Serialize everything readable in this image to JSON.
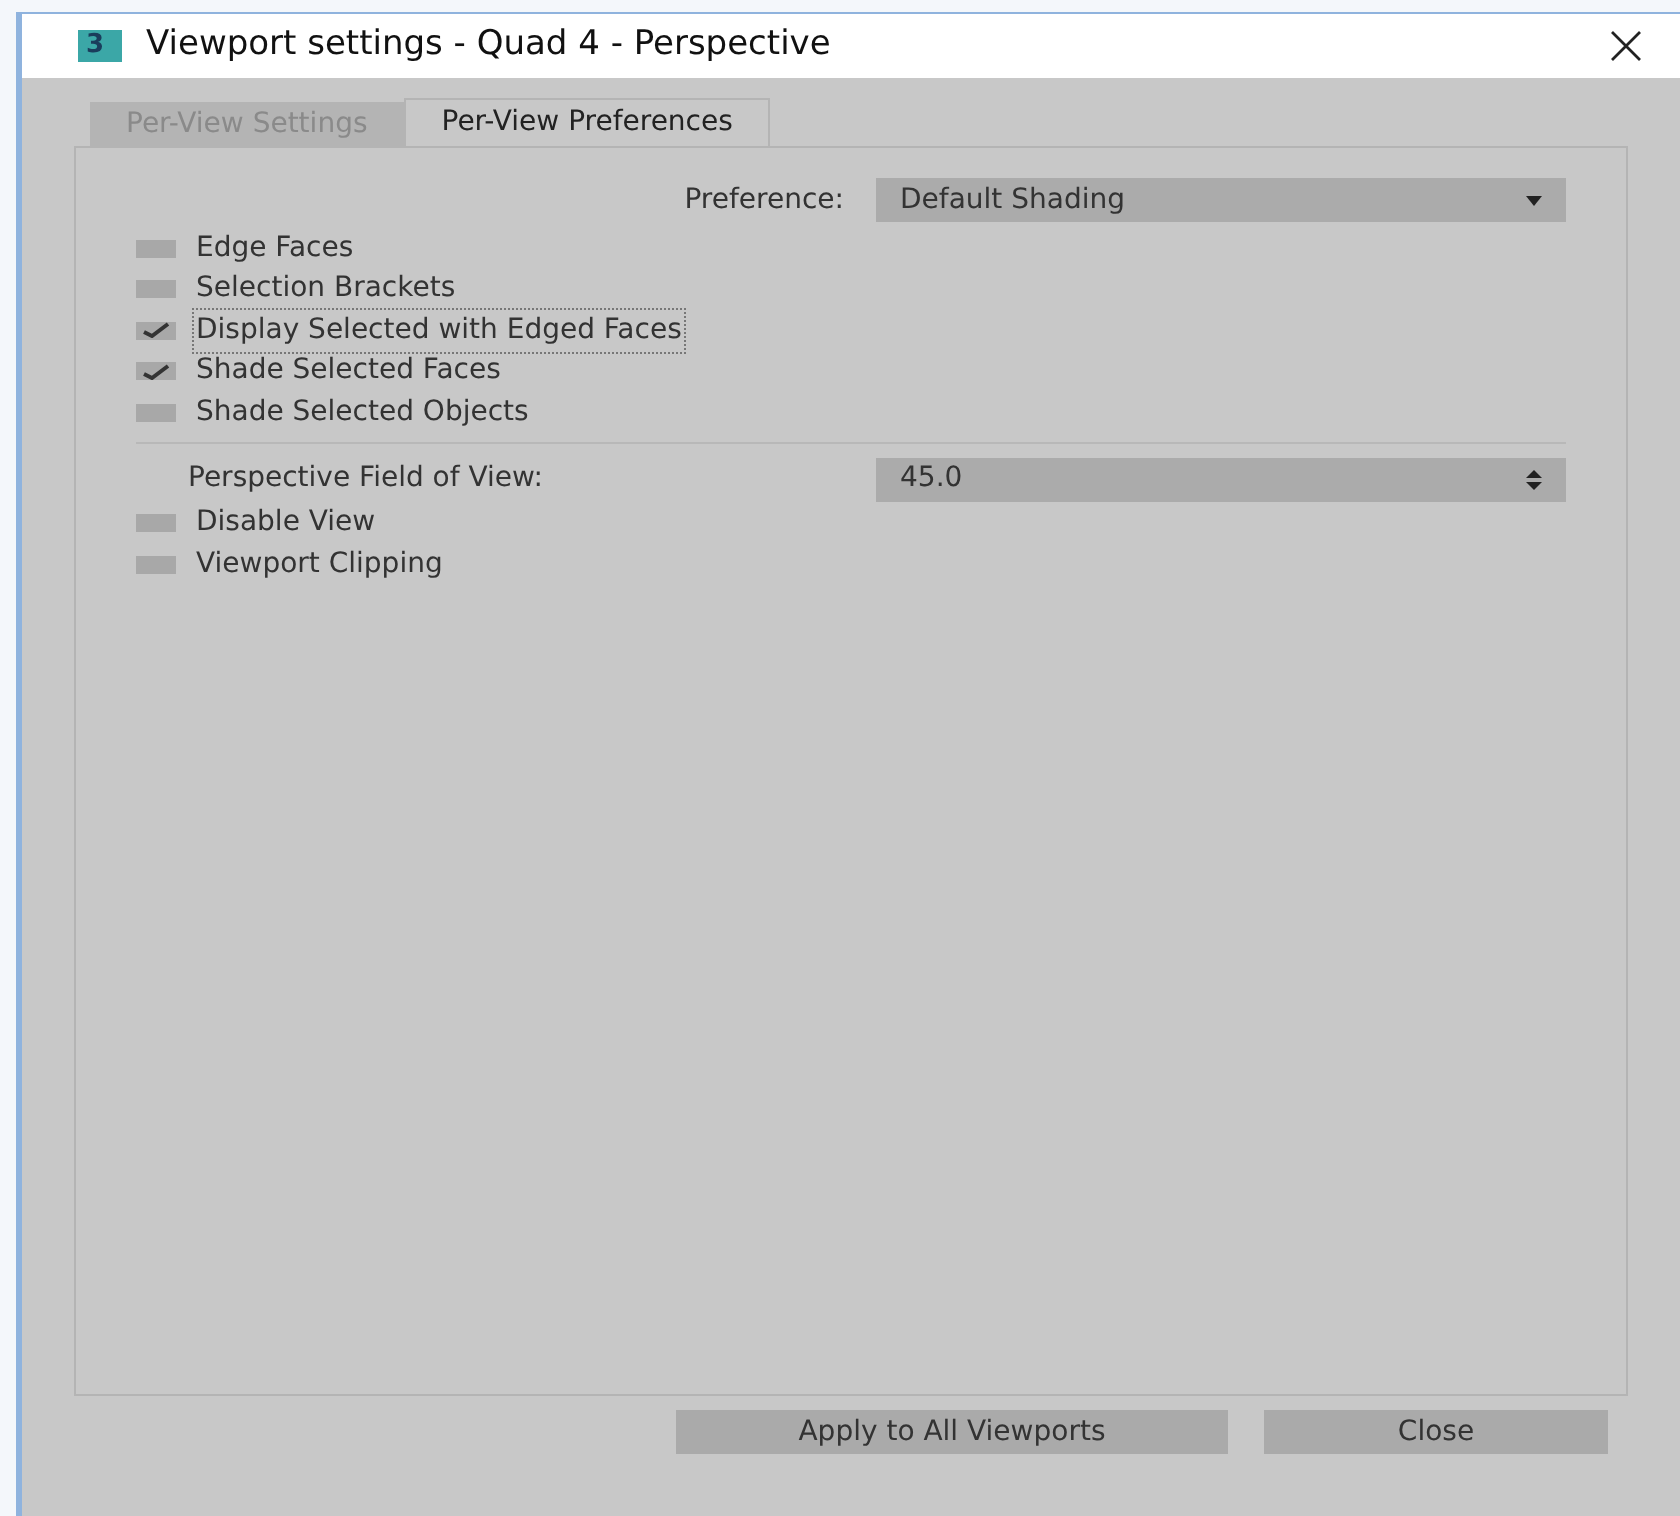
{
  "window": {
    "title": "Viewport settings - Quad 4 - Perspective",
    "logo": "3"
  },
  "tabs": [
    {
      "label": "Per-View Settings",
      "selected": false
    },
    {
      "label": "Per-View Preferences",
      "selected": true
    }
  ],
  "preference": {
    "label": "Preference:",
    "value": "Default Shading"
  },
  "display_options": [
    {
      "label": "Edge Faces",
      "checked": false,
      "focused": false
    },
    {
      "label": "Selection Brackets",
      "checked": false,
      "focused": false
    },
    {
      "label": "Display Selected with Edged Faces",
      "checked": true,
      "focused": true
    },
    {
      "label": "Shade Selected Faces",
      "checked": true,
      "focused": false
    },
    {
      "label": "Shade Selected Objects",
      "checked": false,
      "focused": false
    }
  ],
  "field_of_view": {
    "label": "Perspective Field of View:",
    "value": "45.0"
  },
  "view_options": [
    {
      "label": "Disable View",
      "checked": false,
      "focused": false
    },
    {
      "label": "Viewport Clipping",
      "checked": false,
      "focused": false
    }
  ],
  "buttons": [
    "Apply to All Viewports",
    "Close"
  ]
}
